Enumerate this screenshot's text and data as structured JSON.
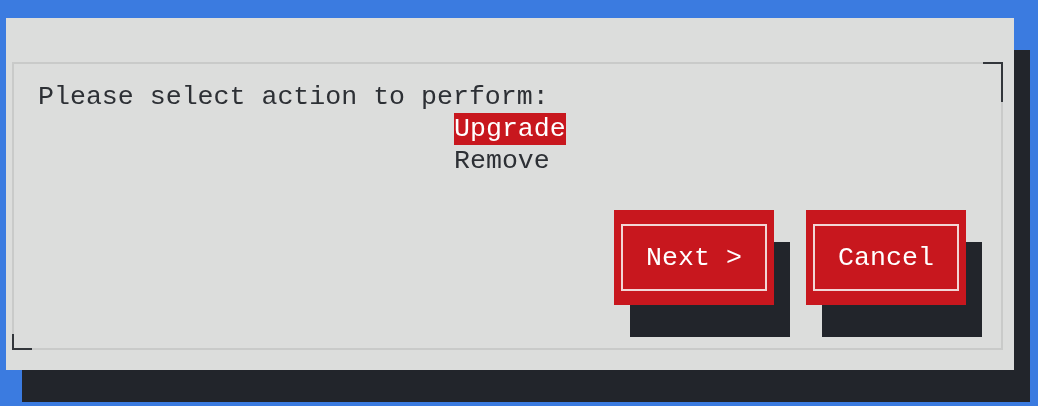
{
  "prompt": "Please select action to perform:",
  "menu": [
    {
      "label": "Upgrade",
      "selected": true
    },
    {
      "label": "Remove",
      "selected": false
    }
  ],
  "buttons": [
    {
      "label": "Next >"
    },
    {
      "label": "Cancel"
    }
  ]
}
